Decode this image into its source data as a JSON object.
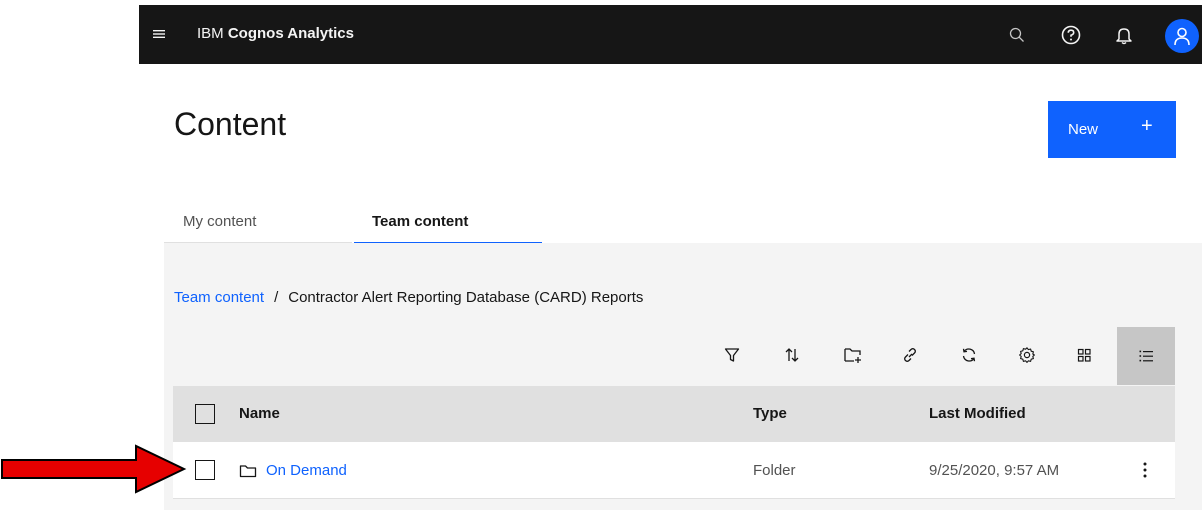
{
  "header": {
    "brand_prefix": "IBM ",
    "brand_name": "Cognos Analytics",
    "icons": [
      "menu-icon",
      "search-icon",
      "help-icon",
      "notification-icon",
      "user-icon"
    ]
  },
  "page": {
    "title": "Content",
    "new_label": "New",
    "new_plus": "+"
  },
  "tabs": [
    {
      "label": "My content",
      "selected": false
    },
    {
      "label": "Team content",
      "selected": true
    }
  ],
  "breadcrumb": {
    "root": "Team content",
    "separator": "/",
    "current": "Contractor Alert Reporting Database (CARD) Reports"
  },
  "toolbar": [
    "filter-icon",
    "sort-icon",
    "new-folder-icon",
    "link-icon",
    "refresh-icon",
    "settings-icon",
    "grid-view-icon",
    "list-view-icon"
  ],
  "table": {
    "columns": [
      "Name",
      "Type",
      "Last Modified"
    ],
    "rows": [
      {
        "name": "On Demand",
        "type": "Folder",
        "modified": "9/25/2020, 9:57 AM"
      }
    ]
  },
  "colors": {
    "accent": "#0f62fe",
    "header_bg": "#161616",
    "panel_bg": "#f4f4f4",
    "annotation_arrow": "#e60000"
  }
}
